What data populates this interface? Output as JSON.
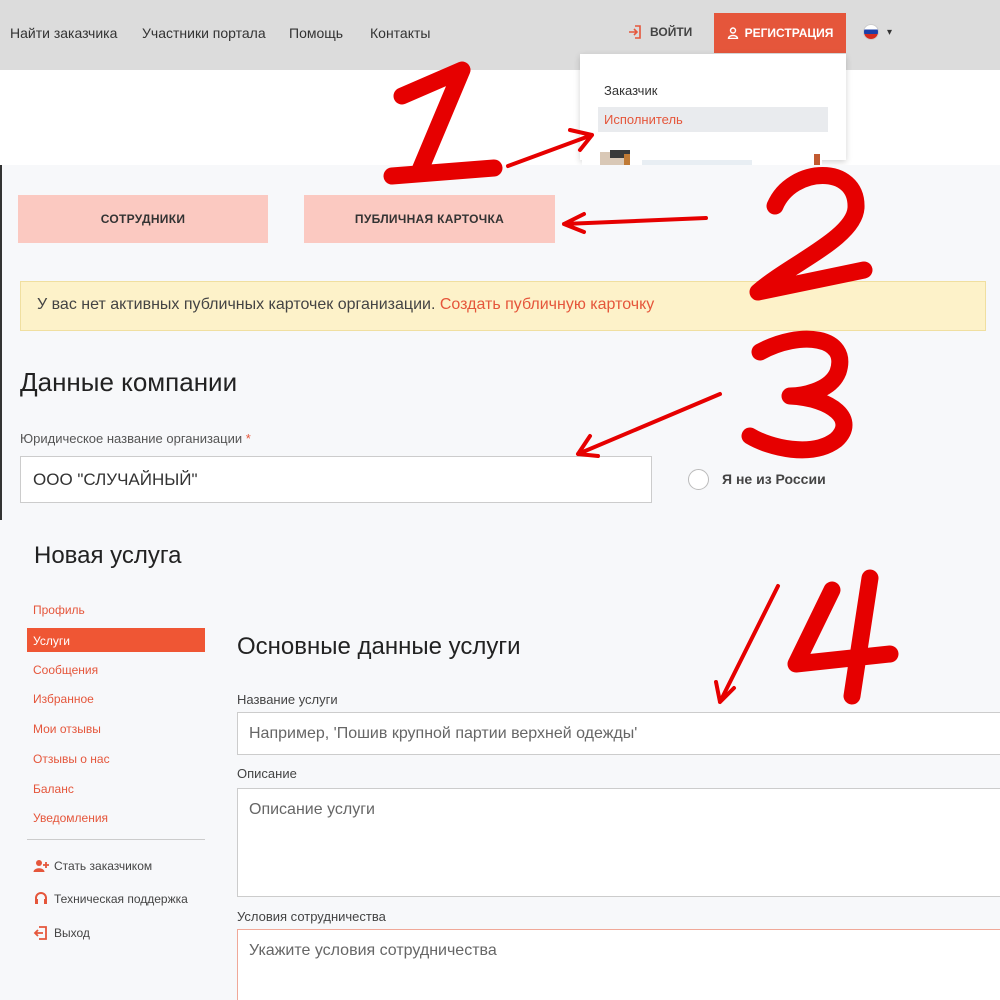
{
  "navbar": {
    "links": [
      "Найти заказчика",
      "Участники портала",
      "Помощь",
      "Контакты"
    ],
    "login_label": "ВОЙТИ",
    "register_label": "РЕГИСТРАЦИЯ",
    "dropdown": [
      "Заказчик",
      "Исполнитель"
    ],
    "lang_caret": "▾"
  },
  "profile": {
    "tabs": [
      "СОТРУДНИКИ",
      "ПУБЛИЧНАЯ КАРТОЧКА"
    ],
    "alert_text": "У вас нет активных публичных карточек организации.",
    "alert_link": "Создать публичную карточку",
    "company_heading": "Данные компании",
    "legal_name_label": "Юридическое название организации",
    "required_mark": "*",
    "legal_name_value": "ООО \"СЛУЧАЙНЫЙ\"",
    "not_russia_label": "Я не из России"
  },
  "service": {
    "page_title": "Новая услуга",
    "sidebar": [
      "Профиль",
      "Услуги",
      "Сообщения",
      "Избранное",
      "Мои отзывы",
      "Отзывы о нас",
      "Баланс",
      "Уведомления"
    ],
    "sidebar_actions": [
      "Стать заказчиком",
      "Техническая поддержка",
      "Выход"
    ],
    "section_heading": "Основные данные услуги",
    "name_label": "Название услуги",
    "name_placeholder": "Например, 'Пошив крупной партии верхней одежды'",
    "description_label": "Описание",
    "description_placeholder": "Описание услуги",
    "terms_label": "Условия сотрудничества",
    "terms_placeholder": "Укажите условия сотрудничества"
  },
  "annotations": [
    "1",
    "2",
    "3",
    "4"
  ],
  "colors": {
    "accent": "#e5563b",
    "tab_pink": "#fbc9c1",
    "alert_bg": "#fdf2c9",
    "annotation_red": "#e60000"
  }
}
